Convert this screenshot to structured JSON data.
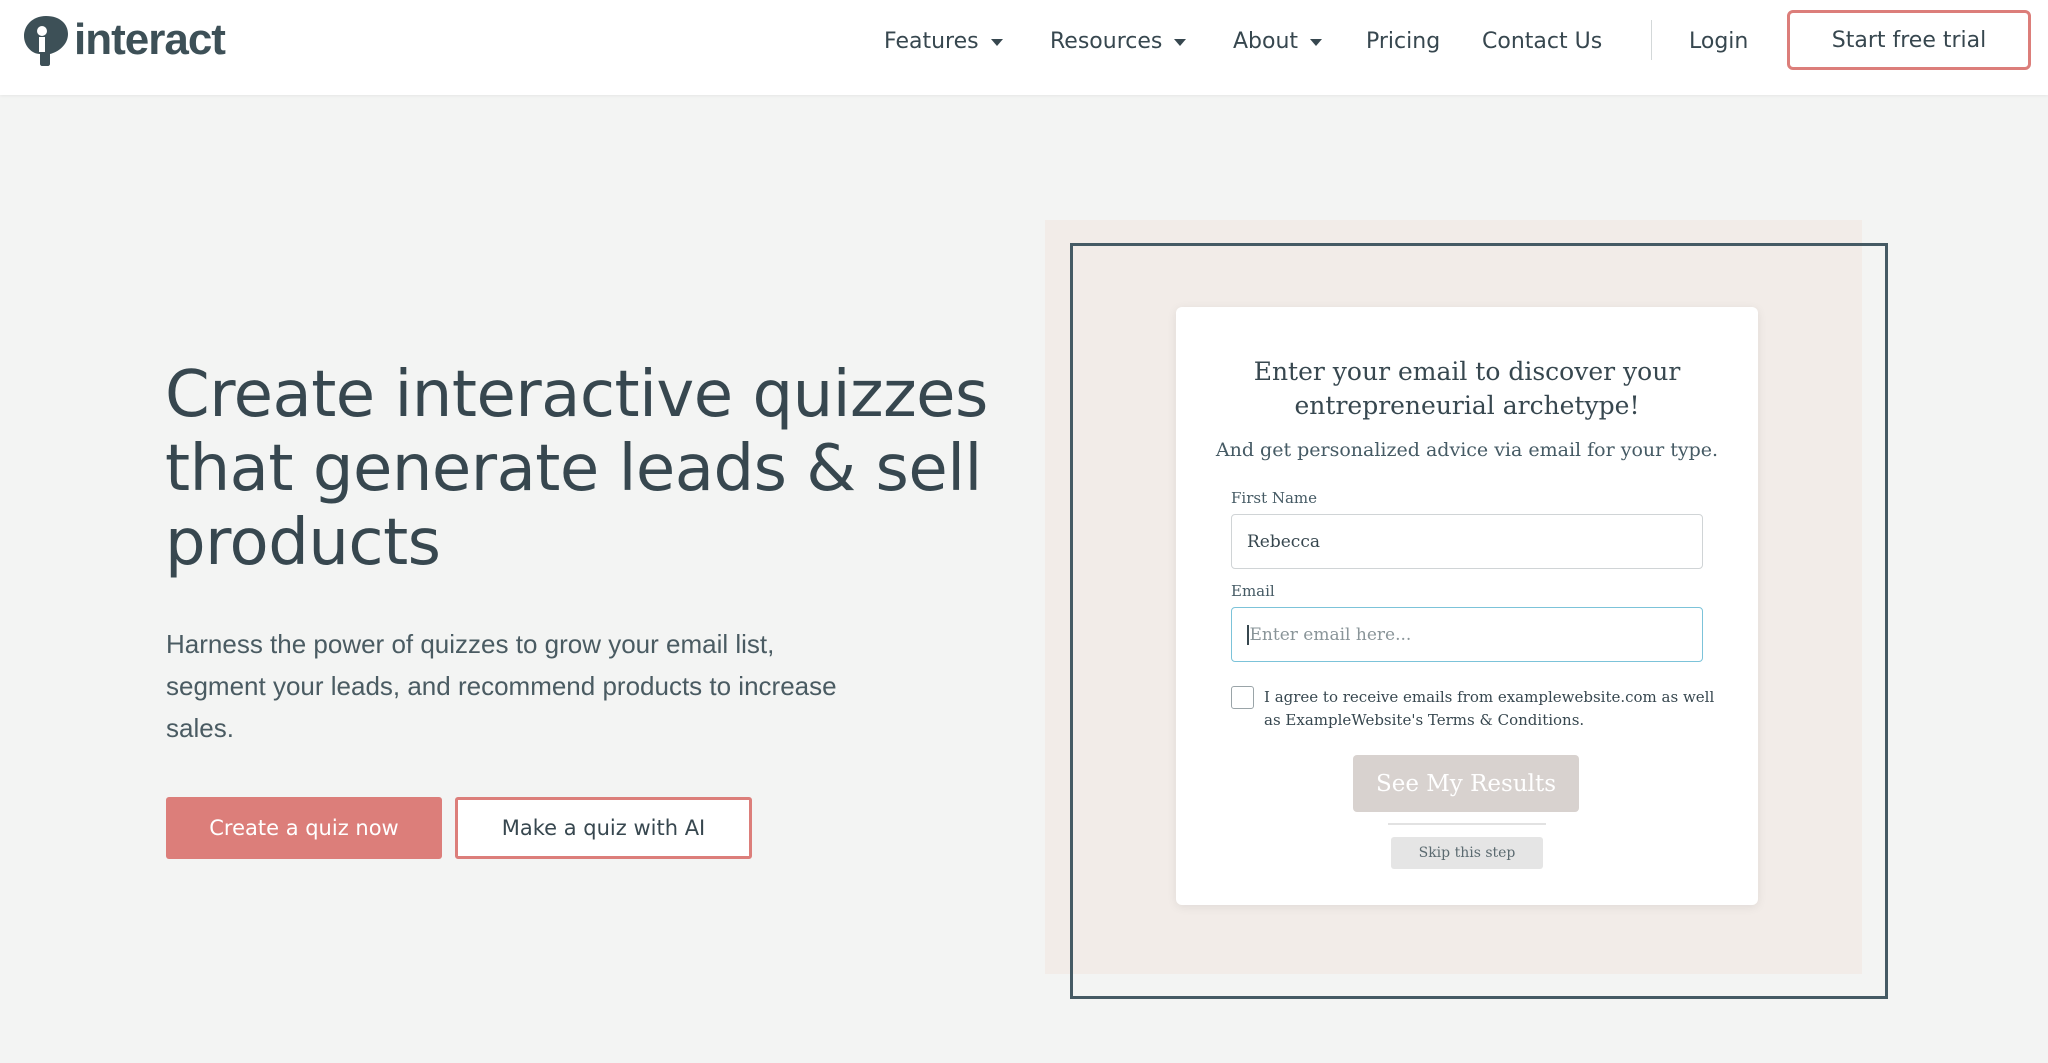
{
  "brand": {
    "name": "interact",
    "accent_color": "#dc7e7a",
    "text_color": "#37474f"
  },
  "nav": {
    "items": [
      {
        "label": "Features",
        "has_dropdown": true
      },
      {
        "label": "Resources",
        "has_dropdown": true
      },
      {
        "label": "About",
        "has_dropdown": true
      },
      {
        "label": "Pricing",
        "has_dropdown": false
      },
      {
        "label": "Contact Us",
        "has_dropdown": false
      }
    ],
    "login_label": "Login",
    "trial_label": "Start free trial"
  },
  "hero": {
    "title": "Create interactive quizzes that generate leads & sell products",
    "subtitle": "Harness the power of quizzes to grow your email list, segment your leads, and recommend products to increase sales.",
    "primary_cta": "Create a quiz now",
    "secondary_cta": "Make a quiz with AI"
  },
  "quiz_preview": {
    "title": "Enter your email to discover your entrepreneurial archetype!",
    "description": "And get personalized advice via email for your type.",
    "first_name_label": "First Name",
    "first_name_value": "Rebecca",
    "email_label": "Email",
    "email_placeholder": "Enter email here...",
    "email_value": "",
    "consent_text": "I agree to receive emails from examplewebsite.com as well as ExampleWebsite's Terms & Conditions.",
    "consent_checked": false,
    "submit_label": "See My Results",
    "skip_label": "Skip this step"
  }
}
